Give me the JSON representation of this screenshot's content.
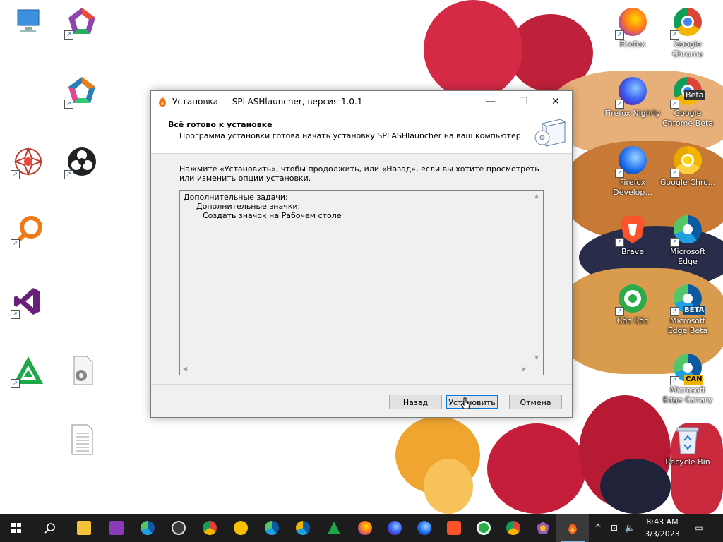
{
  "desktop": {
    "icons": [
      {
        "id": "firefox",
        "label": "Firefox"
      },
      {
        "id": "chrome",
        "label": "Google Chrome"
      },
      {
        "id": "firefox-nightly",
        "label": "Firefox Nightly"
      },
      {
        "id": "chrome-beta",
        "label": "Google Chrome Beta"
      },
      {
        "id": "firefox-dev",
        "label": "Firefox Develop..."
      },
      {
        "id": "chrome-canary",
        "label": "Google Chro..."
      },
      {
        "id": "brave",
        "label": "Brave"
      },
      {
        "id": "edge",
        "label": "Microsoft Edge"
      },
      {
        "id": "coccoc",
        "label": "Cốc Cốc"
      },
      {
        "id": "edge-beta",
        "label": "Microsoft Edge Beta"
      },
      {
        "id": "edge-canary",
        "label": "Microsoft Edge Canary"
      },
      {
        "id": "recycle-bin",
        "label": "Recycle Bin"
      }
    ],
    "badges": {
      "beta": "Beta",
      "beta_caps": "BETA",
      "can": "CAN"
    }
  },
  "window": {
    "title": "Установка — SPLASHlauncher, версия 1.0.1",
    "controls": {
      "minimize": "—",
      "maximize": "☐",
      "close": "✕"
    },
    "header_title": "Всё готово к установке",
    "header_subtitle": "Программа установки готова начать установку SPLASHlauncher на ваш компьютер.",
    "instruction": "Нажмите «Установить», чтобы продолжить, или «Назад», если вы хотите просмотреть или изменить опции установки.",
    "memo_lines": [
      "Дополнительные задачи:",
      "Дополнительные значки:",
      "Создать значок на Рабочем столе"
    ],
    "buttons": {
      "back": "Назад",
      "install": "Установить",
      "cancel": "Отмена"
    }
  },
  "taskbar": {
    "clock_time": "8:43 AM",
    "clock_date": "3/3/2023",
    "tray": {
      "chevron": "^",
      "network": "⊡",
      "volume": "🔈",
      "notifications": "▭"
    }
  },
  "colors": {
    "accent": "#0078d7",
    "taskbar": "#1c1c1c"
  }
}
